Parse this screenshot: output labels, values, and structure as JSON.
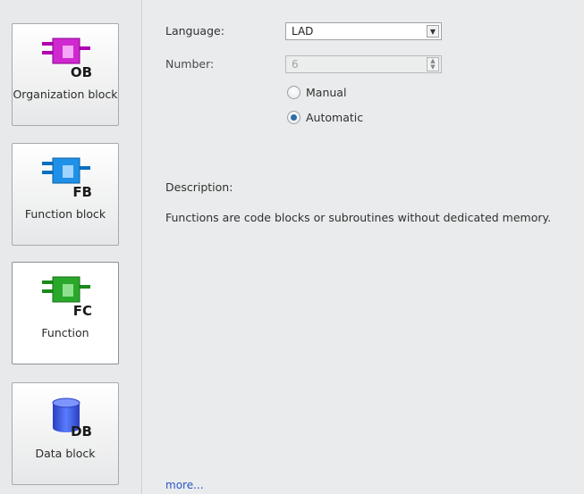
{
  "sidebar": {
    "blocks": [
      {
        "id": "ob",
        "label": "Organization block",
        "icon_text": "OB",
        "color": "#c020c0"
      },
      {
        "id": "fb",
        "label": "Function block",
        "icon_text": "FB",
        "color": "#1a8fe0"
      },
      {
        "id": "fc",
        "label": "Function",
        "icon_text": "FC",
        "color": "#2aa02a",
        "selected": true
      },
      {
        "id": "db",
        "label": "Data block",
        "icon_text": "DB",
        "color": "#3a5bd8"
      }
    ]
  },
  "form": {
    "language_label": "Language:",
    "language_value": "LAD",
    "number_label": "Number:",
    "number_value": "6",
    "radio_manual": "Manual",
    "radio_automatic": "Automatic",
    "selected_numbering": "Automatic"
  },
  "description": {
    "label": "Description:",
    "text": "Functions are code blocks or subroutines without dedicated memory."
  },
  "more_link": "more..."
}
